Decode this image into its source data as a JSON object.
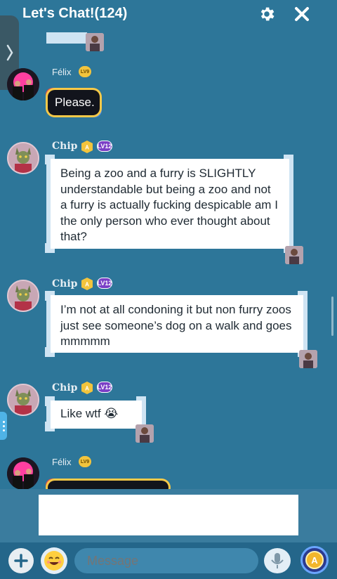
{
  "header": {
    "title": "Let's Chat!(124)",
    "settings_icon": "gear-icon",
    "close_icon": "close-icon"
  },
  "messages": [
    {
      "user": "Félix",
      "level": "LV9",
      "text": "Please.",
      "style": "dark-rainbow"
    },
    {
      "user": "Chip",
      "level": "LV12",
      "text": "Being a zoo and a furry is SLIGHTLY understandable but being a zoo and not a furry is actually fucking despicable am I the only person who ever thought about that?",
      "style": "white"
    },
    {
      "user": "Chip",
      "level": "LV12",
      "text": "I’m not at all condoning it but non furry zoos just see someone’s dog on a walk and goes mmmmm",
      "style": "white"
    },
    {
      "user": "Chip",
      "level": "LV12",
      "text": "Like wtf 😭",
      "style": "white"
    },
    {
      "user": "Félix",
      "level": "LV9",
      "text": "",
      "style": "dark-rainbow"
    }
  ],
  "composer": {
    "placeholder": "Message",
    "plus_icon": "plus-icon",
    "emoji_icon": "emoji-icon",
    "mic_icon": "microphone-icon",
    "coin_icon": "coin-icon"
  },
  "colors": {
    "background": "#2d7699",
    "bottom_bar": "#24668a",
    "bubble_frame": "#cfe4f3",
    "level_gold": "#f2c43d",
    "level_purple": "#7a3fc6"
  }
}
